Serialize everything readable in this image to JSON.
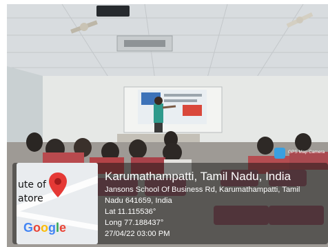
{
  "map": {
    "snippet_line1": "ute of",
    "snippet_line2": "atore",
    "logo_text": "Google"
  },
  "location": {
    "title": "Karumathampatti, Tamil Nadu, India",
    "address_line1": "Jansons School Of Business Rd, Karumathampatti, Tamil",
    "address_line2": "Nadu 641659, India",
    "latitude": "Lat 11.115536°",
    "longitude": "Long 77.188437°",
    "timestamp": "27/04/22 03:00 PM"
  },
  "camera_badge": {
    "label": "GPS Map Camera",
    "icon": "camera-app-icon"
  },
  "colors": {
    "overlay": "#141414",
    "pin": "#e53935",
    "google_blue": "#4285F4",
    "google_red": "#EA4335",
    "google_yellow": "#FBBC05",
    "google_green": "#34A853"
  }
}
